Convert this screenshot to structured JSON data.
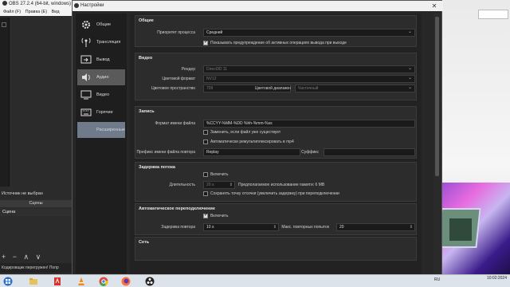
{
  "obs": {
    "title": "OBS 27.2.4 (64-bit, windows) - ",
    "menu": [
      "Файл (F)",
      "Правка (E)",
      "Вид"
    ],
    "source_none": "Источник не выбран",
    "scenes_header": "Сцены",
    "scene_item": "Сцена",
    "scene_controls": "+ − ∧ ∨",
    "status": "Кодировщик перегружен! Попр"
  },
  "dialog": {
    "title": "Настройки",
    "close": "✕"
  },
  "sidebar": {
    "items": [
      {
        "label": "Общие",
        "icon": "gear-icon"
      },
      {
        "label": "Трансляция",
        "icon": "broadcast-icon"
      },
      {
        "label": "Вывод",
        "icon": "output-icon"
      },
      {
        "label": "Аудио",
        "icon": "speaker-icon"
      },
      {
        "label": "Видео",
        "icon": "monitor-icon"
      },
      {
        "label": "Горячие клавиши",
        "icon": "keyboard-icon"
      },
      {
        "label": "Расширенные",
        "icon": "advanced-icon"
      }
    ]
  },
  "general": {
    "title": "Общие",
    "priority_label": "Приоритет процесса",
    "priority_value": "Средний",
    "warn_label": "Показывать предупреждение об активных операциях вывода при выходе"
  },
  "video": {
    "title": "Видео",
    "renderer_label": "Рендер",
    "renderer_value": "Direct3D 11",
    "format_label": "Цветовой формат",
    "format_value": "NV12",
    "space_label": "Цветовое пространство",
    "space_value": "709",
    "range_label": "Цветовой диапазон",
    "range_value": "Частичный"
  },
  "recording": {
    "title": "Запись",
    "fname_label": "Формат имени файла",
    "fname_value": "%CCYY-%MM-%DD %hh-%mm-%ss",
    "overwrite_label": "Заменить, если файл уже существует",
    "remux_label": "Автоматически ремультиплексировать в mp4",
    "replay_prefix_label": "Префикс имени файла повтора",
    "replay_prefix_value": "Replay",
    "suffix_label": "Суффикс"
  },
  "delay": {
    "title": "Задержка потока",
    "enable_label": "Включить",
    "duration_label": "Длительность",
    "duration_value": "20 s",
    "mem_label": "Предполагаемое использование памяти: 6 MB",
    "preserve_label": "Сохранять точку отсечки (увеличить задержку) при переподключении"
  },
  "reconnect": {
    "title": "Автоматическое переподключение",
    "enable_label": "Включить",
    "delay_label": "Задержка повтора",
    "delay_value": "10 s",
    "max_label": "Макс. повторных попыток",
    "max_value": "20"
  },
  "network": {
    "title": "Сеть"
  },
  "taskbar": {
    "tray": "RU",
    "time": "10:02:2024"
  }
}
